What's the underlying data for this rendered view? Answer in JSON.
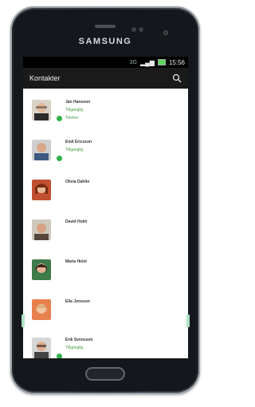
{
  "device": {
    "brand": "SAMSUNG"
  },
  "statusbar": {
    "time": "15:56",
    "network": "3G"
  },
  "appbar": {
    "title": "Kontakter"
  },
  "contacts": [
    {
      "name": "Jan Hansson",
      "status": "Tillgänglig",
      "extra": "Telefon"
    },
    {
      "name": "Emil Ericsson",
      "status": "Tillgänglig",
      "extra": ""
    },
    {
      "name": "Olivia Dahlin",
      "status": "",
      "extra": ""
    },
    {
      "name": "David Holm",
      "status": "",
      "extra": ""
    },
    {
      "name": "Maria Holst",
      "status": "",
      "extra": ""
    },
    {
      "name": "Ella Jonsson",
      "status": "",
      "extra": ""
    },
    {
      "name": "Erik Svensson",
      "status": "Tillgänglig",
      "extra": ""
    }
  ],
  "colors": {
    "available": "#32b24a",
    "appbar": "#1a1a1a"
  },
  "icons": {
    "search": "search-icon"
  }
}
